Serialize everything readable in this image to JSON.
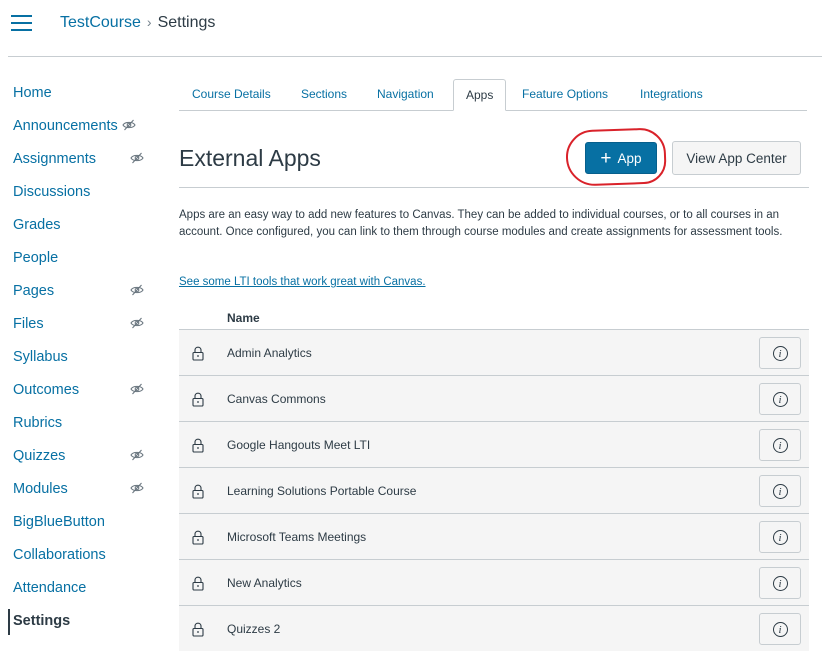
{
  "breadcrumb": {
    "course": "TestCourse",
    "separator": "›",
    "current": "Settings"
  },
  "course_nav": {
    "items": [
      {
        "label": "Home",
        "hidden": false
      },
      {
        "label": "Announcements",
        "hidden": true
      },
      {
        "label": "Assignments",
        "hidden": true
      },
      {
        "label": "Discussions",
        "hidden": false
      },
      {
        "label": "Grades",
        "hidden": false
      },
      {
        "label": "People",
        "hidden": false
      },
      {
        "label": "Pages",
        "hidden": true
      },
      {
        "label": "Files",
        "hidden": true
      },
      {
        "label": "Syllabus",
        "hidden": false
      },
      {
        "label": "Outcomes",
        "hidden": true
      },
      {
        "label": "Rubrics",
        "hidden": false
      },
      {
        "label": "Quizzes",
        "hidden": true
      },
      {
        "label": "Modules",
        "hidden": true
      },
      {
        "label": "BigBlueButton",
        "hidden": false
      },
      {
        "label": "Collaborations",
        "hidden": false
      },
      {
        "label": "Attendance",
        "hidden": false
      },
      {
        "label": "Settings",
        "hidden": false,
        "active": true
      }
    ]
  },
  "tabs": [
    "Course Details",
    "Sections",
    "Navigation",
    "Apps",
    "Feature Options",
    "Integrations"
  ],
  "active_tab": "Apps",
  "main": {
    "title": "External Apps",
    "add_app_label": "App",
    "add_app_icon": "plus-icon",
    "view_app_center_label": "View App Center",
    "description": "Apps are an easy way to add new features to Canvas. They can be added to individual courses, or to all courses in an account. Once configured, you can link to them through course modules and create assignments for assessment tools.",
    "lti_link": "See some LTI tools that work great with Canvas.",
    "column_name": "Name"
  },
  "apps": [
    "Admin Analytics",
    "Canvas Commons",
    "Google Hangouts Meet LTI",
    "Learning Solutions Portable Course",
    "Microsoft Teams Meetings",
    "New Analytics",
    "Quizzes 2"
  ],
  "colors": {
    "link": "#0770a3",
    "primary_button": "#0770a3",
    "text": "#2d3b45",
    "row_bg": "#f5f5f5",
    "annotation": "#d9222a"
  }
}
